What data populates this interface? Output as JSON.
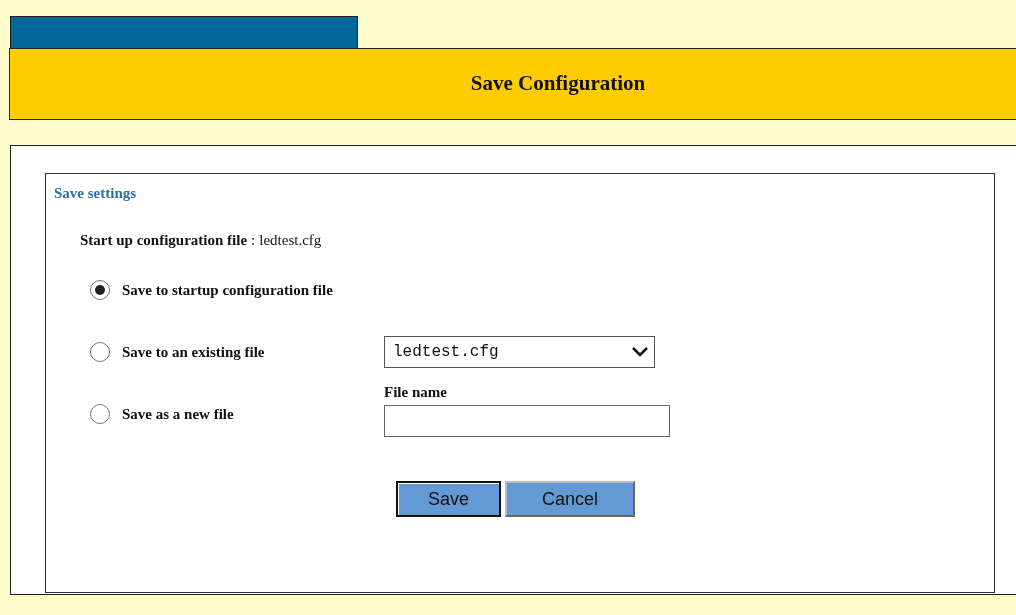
{
  "header": {
    "title": "Save Configuration"
  },
  "panel": {
    "legend": "Save settings",
    "startup_label": "Start up configuration file",
    "startup_separator": ":",
    "startup_value": "ledtest.cfg",
    "options": [
      {
        "label": "Save to startup configuration file",
        "selected": true
      },
      {
        "label": "Save to an existing file",
        "selected": false,
        "control": {
          "kind": "select",
          "value": "ledtest.cfg"
        }
      },
      {
        "label": "Save as a new file",
        "selected": false,
        "control": {
          "kind": "text",
          "label": "File name"
        }
      }
    ],
    "buttons": [
      {
        "label": "Save",
        "default": true
      },
      {
        "label": "Cancel",
        "default": false
      }
    ]
  }
}
